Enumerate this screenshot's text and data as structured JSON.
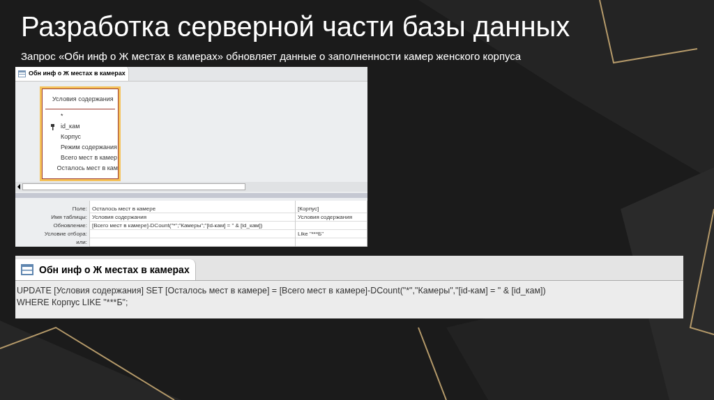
{
  "slide": {
    "title": "Разработка серверной части базы данных",
    "subtitle": "Запрос «Обн инф о Ж местах в камерах» обновляет данные о заполненности камер женского корпуса"
  },
  "design_view": {
    "tab_title": "Обн инф о Ж местах в камерах",
    "table": {
      "title": "Условия содержания",
      "fields": [
        {
          "name": "*",
          "primary_key": false
        },
        {
          "name": "id_кам",
          "primary_key": true
        },
        {
          "name": "Корпус",
          "primary_key": false
        },
        {
          "name": "Режим содержания",
          "primary_key": false
        },
        {
          "name": "Всего мест в камер",
          "primary_key": false
        },
        {
          "name": "Осталось мест в кам",
          "primary_key": false
        }
      ]
    },
    "grid": {
      "rows": [
        {
          "label": "Поле:",
          "cells": [
            "Осталось мест в камере",
            "[Корпус]"
          ]
        },
        {
          "label": "Имя таблицы:",
          "cells": [
            "Условия содержания",
            "Условия содержания"
          ]
        },
        {
          "label": "Обновление:",
          "cells": [
            "[Всего мест в камере]-DCount(\"*\";\"Камеры\";\"[id-кам] = \" & [id_кам])",
            null
          ]
        },
        {
          "label": "Условие отбора:",
          "cells": [
            null,
            "Like \"***Б\""
          ]
        },
        {
          "label": "или:",
          "cells": [
            null,
            null
          ]
        }
      ]
    }
  },
  "sql_view": {
    "tab_title": "Обн инф о Ж местах в камерах",
    "lines": [
      "UPDATE [Условия содержания] SET [Осталось мест в камере] = [Всего мест в камере]-DCount(\"*\",\"Камеры\",\"[id-кам] = \" & [id_кам])",
      "WHERE Корпус LIKE \"***Б\";"
    ]
  }
}
